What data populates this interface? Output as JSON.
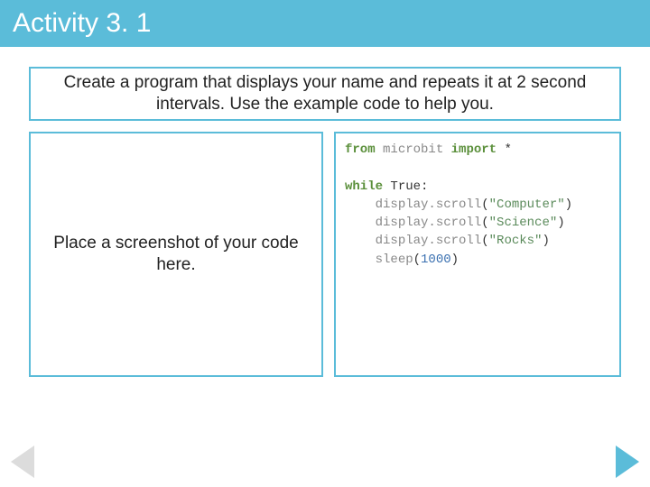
{
  "title": "Activity 3. 1",
  "instruction": "Create a program that displays your name and repeats it at 2 second intervals. Use the example code to help you.",
  "placeholder": "Place a screenshot of your code here.",
  "code": {
    "import_line": {
      "kw1": "from",
      "mod": "microbit",
      "kw2": "import",
      "star": "*"
    },
    "while_line": {
      "kw": "while",
      "cond": "True",
      "colon": ":"
    },
    "body": [
      {
        "call": "display.scroll",
        "arg": "\"Computer\""
      },
      {
        "call": "display.scroll",
        "arg": "\"Science\""
      },
      {
        "call": "display.scroll",
        "arg": "\"Rocks\""
      },
      {
        "call": "sleep",
        "num": "1000"
      }
    ]
  }
}
